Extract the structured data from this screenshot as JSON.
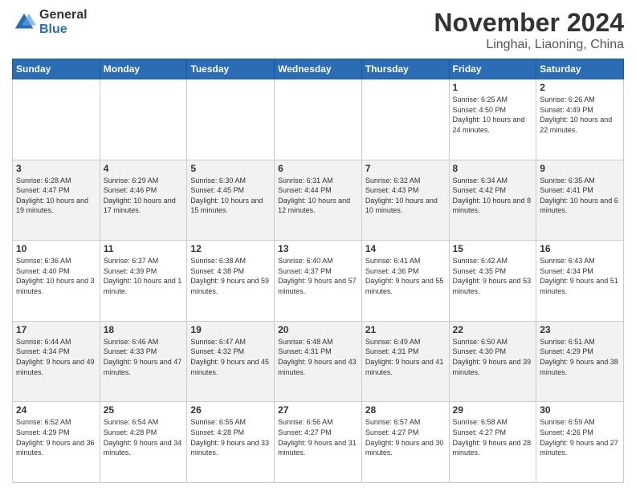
{
  "logo": {
    "general": "General",
    "blue": "Blue"
  },
  "header": {
    "month": "November 2024",
    "location": "Linghai, Liaoning, China"
  },
  "weekdays": [
    "Sunday",
    "Monday",
    "Tuesday",
    "Wednesday",
    "Thursday",
    "Friday",
    "Saturday"
  ],
  "weeks": [
    [
      {
        "day": "",
        "sunrise": "",
        "sunset": "",
        "daylight": ""
      },
      {
        "day": "",
        "sunrise": "",
        "sunset": "",
        "daylight": ""
      },
      {
        "day": "",
        "sunrise": "",
        "sunset": "",
        "daylight": ""
      },
      {
        "day": "",
        "sunrise": "",
        "sunset": "",
        "daylight": ""
      },
      {
        "day": "",
        "sunrise": "",
        "sunset": "",
        "daylight": ""
      },
      {
        "day": "1",
        "sunrise": "Sunrise: 6:25 AM",
        "sunset": "Sunset: 4:50 PM",
        "daylight": "Daylight: 10 hours and 24 minutes."
      },
      {
        "day": "2",
        "sunrise": "Sunrise: 6:26 AM",
        "sunset": "Sunset: 4:49 PM",
        "daylight": "Daylight: 10 hours and 22 minutes."
      }
    ],
    [
      {
        "day": "3",
        "sunrise": "Sunrise: 6:28 AM",
        "sunset": "Sunset: 4:47 PM",
        "daylight": "Daylight: 10 hours and 19 minutes."
      },
      {
        "day": "4",
        "sunrise": "Sunrise: 6:29 AM",
        "sunset": "Sunset: 4:46 PM",
        "daylight": "Daylight: 10 hours and 17 minutes."
      },
      {
        "day": "5",
        "sunrise": "Sunrise: 6:30 AM",
        "sunset": "Sunset: 4:45 PM",
        "daylight": "Daylight: 10 hours and 15 minutes."
      },
      {
        "day": "6",
        "sunrise": "Sunrise: 6:31 AM",
        "sunset": "Sunset: 4:44 PM",
        "daylight": "Daylight: 10 hours and 12 minutes."
      },
      {
        "day": "7",
        "sunrise": "Sunrise: 6:32 AM",
        "sunset": "Sunset: 4:43 PM",
        "daylight": "Daylight: 10 hours and 10 minutes."
      },
      {
        "day": "8",
        "sunrise": "Sunrise: 6:34 AM",
        "sunset": "Sunset: 4:42 PM",
        "daylight": "Daylight: 10 hours and 8 minutes."
      },
      {
        "day": "9",
        "sunrise": "Sunrise: 6:35 AM",
        "sunset": "Sunset: 4:41 PM",
        "daylight": "Daylight: 10 hours and 6 minutes."
      }
    ],
    [
      {
        "day": "10",
        "sunrise": "Sunrise: 6:36 AM",
        "sunset": "Sunset: 4:40 PM",
        "daylight": "Daylight: 10 hours and 3 minutes."
      },
      {
        "day": "11",
        "sunrise": "Sunrise: 6:37 AM",
        "sunset": "Sunset: 4:39 PM",
        "daylight": "Daylight: 10 hours and 1 minute."
      },
      {
        "day": "12",
        "sunrise": "Sunrise: 6:38 AM",
        "sunset": "Sunset: 4:38 PM",
        "daylight": "Daylight: 9 hours and 59 minutes."
      },
      {
        "day": "13",
        "sunrise": "Sunrise: 6:40 AM",
        "sunset": "Sunset: 4:37 PM",
        "daylight": "Daylight: 9 hours and 57 minutes."
      },
      {
        "day": "14",
        "sunrise": "Sunrise: 6:41 AM",
        "sunset": "Sunset: 4:36 PM",
        "daylight": "Daylight: 9 hours and 55 minutes."
      },
      {
        "day": "15",
        "sunrise": "Sunrise: 6:42 AM",
        "sunset": "Sunset: 4:35 PM",
        "daylight": "Daylight: 9 hours and 53 minutes."
      },
      {
        "day": "16",
        "sunrise": "Sunrise: 6:43 AM",
        "sunset": "Sunset: 4:34 PM",
        "daylight": "Daylight: 9 hours and 51 minutes."
      }
    ],
    [
      {
        "day": "17",
        "sunrise": "Sunrise: 6:44 AM",
        "sunset": "Sunset: 4:34 PM",
        "daylight": "Daylight: 9 hours and 49 minutes."
      },
      {
        "day": "18",
        "sunrise": "Sunrise: 6:46 AM",
        "sunset": "Sunset: 4:33 PM",
        "daylight": "Daylight: 9 hours and 47 minutes."
      },
      {
        "day": "19",
        "sunrise": "Sunrise: 6:47 AM",
        "sunset": "Sunset: 4:32 PM",
        "daylight": "Daylight: 9 hours and 45 minutes."
      },
      {
        "day": "20",
        "sunrise": "Sunrise: 6:48 AM",
        "sunset": "Sunset: 4:31 PM",
        "daylight": "Daylight: 9 hours and 43 minutes."
      },
      {
        "day": "21",
        "sunrise": "Sunrise: 6:49 AM",
        "sunset": "Sunset: 4:31 PM",
        "daylight": "Daylight: 9 hours and 41 minutes."
      },
      {
        "day": "22",
        "sunrise": "Sunrise: 6:50 AM",
        "sunset": "Sunset: 4:30 PM",
        "daylight": "Daylight: 9 hours and 39 minutes."
      },
      {
        "day": "23",
        "sunrise": "Sunrise: 6:51 AM",
        "sunset": "Sunset: 4:29 PM",
        "daylight": "Daylight: 9 hours and 38 minutes."
      }
    ],
    [
      {
        "day": "24",
        "sunrise": "Sunrise: 6:52 AM",
        "sunset": "Sunset: 4:29 PM",
        "daylight": "Daylight: 9 hours and 36 minutes."
      },
      {
        "day": "25",
        "sunrise": "Sunrise: 6:54 AM",
        "sunset": "Sunset: 4:28 PM",
        "daylight": "Daylight: 9 hours and 34 minutes."
      },
      {
        "day": "26",
        "sunrise": "Sunrise: 6:55 AM",
        "sunset": "Sunset: 4:28 PM",
        "daylight": "Daylight: 9 hours and 33 minutes."
      },
      {
        "day": "27",
        "sunrise": "Sunrise: 6:56 AM",
        "sunset": "Sunset: 4:27 PM",
        "daylight": "Daylight: 9 hours and 31 minutes."
      },
      {
        "day": "28",
        "sunrise": "Sunrise: 6:57 AM",
        "sunset": "Sunset: 4:27 PM",
        "daylight": "Daylight: 9 hours and 30 minutes."
      },
      {
        "day": "29",
        "sunrise": "Sunrise: 6:58 AM",
        "sunset": "Sunset: 4:27 PM",
        "daylight": "Daylight: 9 hours and 28 minutes."
      },
      {
        "day": "30",
        "sunrise": "Sunrise: 6:59 AM",
        "sunset": "Sunset: 4:26 PM",
        "daylight": "Daylight: 9 hours and 27 minutes."
      }
    ]
  ]
}
